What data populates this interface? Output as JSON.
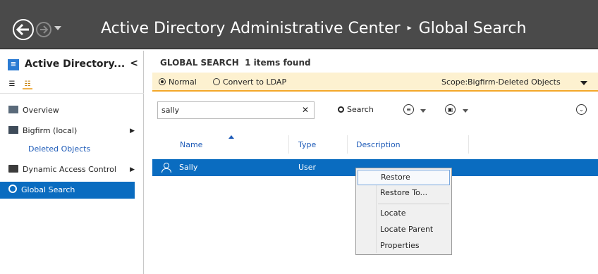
{
  "window": {
    "title": "Active Directory Administrative Center",
    "breadcrumb_sep": "▸",
    "current_page": "Global Search"
  },
  "leftnav": {
    "app_title": "Active Directory...",
    "collapse_glyph": "<",
    "items": [
      {
        "label": "Overview",
        "icon": "overview-icon"
      },
      {
        "label": "Bigfirm (local)",
        "icon": "domain-icon",
        "expandable": true
      },
      {
        "label": "Deleted Objects",
        "indent": true
      },
      {
        "label": "Dynamic Access Control",
        "icon": "folder-icon",
        "expandable": true
      },
      {
        "label": "Global Search",
        "icon": "search-icon",
        "selected": true
      }
    ]
  },
  "main": {
    "header_title": "GLOBAL SEARCH",
    "header_count": "1 items found",
    "mode": {
      "normal_label": "Normal",
      "ldap_label": "Convert to LDAP",
      "selected": "Normal"
    },
    "scope_label": "Scope:",
    "scope_value": "Bigfirm-Deleted Objects",
    "search": {
      "value": "sally",
      "clear_glyph": "✕",
      "button_label": "Search"
    },
    "columns": [
      "Name",
      "Type",
      "Description"
    ],
    "rows": [
      {
        "name": "Sally",
        "type": "User",
        "description": ""
      }
    ]
  },
  "context_menu": {
    "items": [
      "Restore",
      "Restore To...",
      "Locate",
      "Locate Parent",
      "Properties"
    ]
  },
  "colors": {
    "titlebar": "#4a4a4a",
    "selection": "#0a6cc0",
    "mode_bar": "#fdf1d0",
    "accent_orange": "#f3a72a"
  }
}
